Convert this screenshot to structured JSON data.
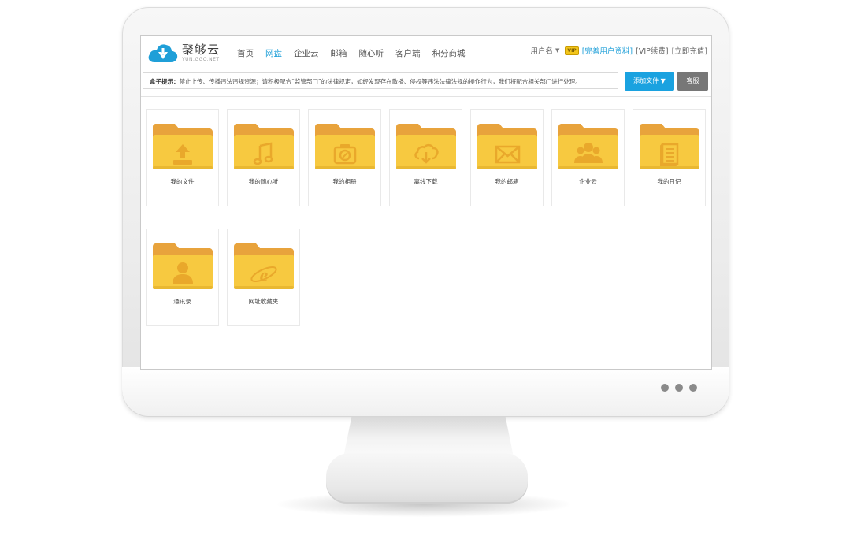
{
  "app": {
    "logo_name": "聚够云",
    "logo_sub": "YUN.GGO.NET"
  },
  "nav": {
    "items": [
      {
        "label": "首页",
        "active": false
      },
      {
        "label": "网盘",
        "active": true
      },
      {
        "label": "企业云",
        "active": false
      },
      {
        "label": "邮箱",
        "active": false
      },
      {
        "label": "随心听",
        "active": false
      },
      {
        "label": "客户端",
        "active": false
      },
      {
        "label": "积分商城",
        "active": false
      }
    ]
  },
  "user": {
    "username": "用户名",
    "vip_badge": "VIP",
    "complete_profile": "[完善用户资料]",
    "vip_renew": "[VIP续费]",
    "recharge": "[立即充值]"
  },
  "notice": {
    "title": "盒子提示：",
    "text": "禁止上传、传播违法违规资源；请积极配合“监管部门”的法律规定，如经发现存在散播、侵权等违法法律法规的操作行为，我们将配合相关部门进行处理。"
  },
  "toolbar": {
    "add_file": "添加文件 ▼",
    "service": "客服"
  },
  "folders": [
    {
      "label": "我的文件",
      "icon": "upload-icon"
    },
    {
      "label": "我的随心听",
      "icon": "music-note-icon"
    },
    {
      "label": "我的相册",
      "icon": "camera-icon"
    },
    {
      "label": "离线下载",
      "icon": "cloud-download-icon"
    },
    {
      "label": "我的邮箱",
      "icon": "envelope-icon"
    },
    {
      "label": "企业云",
      "icon": "group-icon"
    },
    {
      "label": "我的日记",
      "icon": "notebook-icon"
    },
    {
      "label": "通讯录",
      "icon": "person-icon"
    },
    {
      "label": "网址收藏夹",
      "icon": "browser-e-icon"
    }
  ],
  "colors": {
    "accent_blue": "#1aa2e0",
    "folder_yellow": "#f7c940",
    "folder_tab": "#e8a33c",
    "icon_orange": "#e9a82b"
  }
}
